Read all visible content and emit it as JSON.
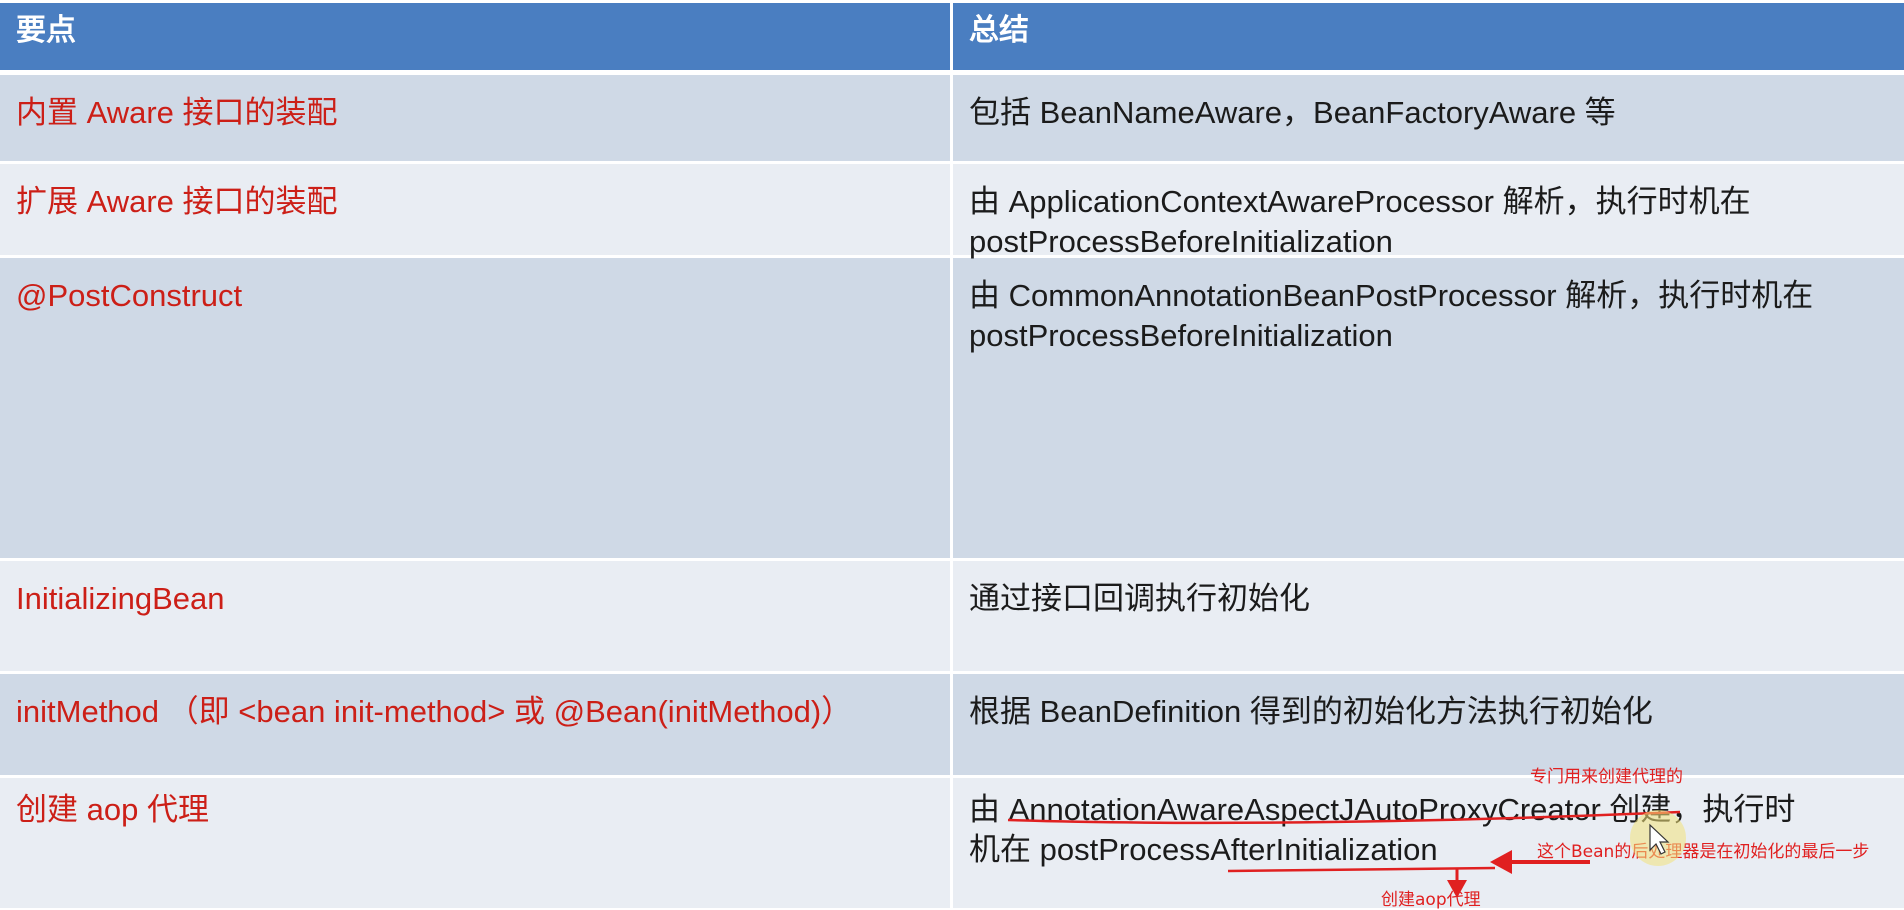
{
  "header": {
    "col1": "要点",
    "col2": "总结"
  },
  "rows": [
    {
      "key": "内置 Aware 接口的装配",
      "summary": "包括 BeanNameAware，BeanFactoryAware 等"
    },
    {
      "key": "扩展 Aware 接口的装配",
      "summary_l1": "由 ApplicationContextAwareProcessor 解析，执行时机在",
      "summary_l2": "postProcessBeforeInitialization"
    },
    {
      "key": "@PostConstruct",
      "summary_l1": "由 CommonAnnotationBeanPostProcessor 解析，执行时机在",
      "summary_l2": "postProcessBeforeInitialization"
    },
    {
      "key": "InitializingBean",
      "summary": "通过接口回调执行初始化"
    },
    {
      "key": "initMethod （即 <bean init-method> 或 @Bean(initMethod)）",
      "summary": "根据 BeanDefinition 得到的初始化方法执行初始化"
    },
    {
      "key": "创建 aop 代理",
      "summary_l1": "由 AnnotationAwareAspectJAutoProxyCreator 创建，执行时",
      "summary_l2": "机在 postProcessAfterInitialization"
    }
  ],
  "annotations": {
    "top_note": "专门用来创建代理的",
    "side_note": "这个Bean的后处理器是在初始化的最后一步",
    "bottom_note": "创建aop代理"
  },
  "colors": {
    "header_bg": "#4a7ec1",
    "row_dark": "#cfd9e6",
    "row_light": "#e9edf3",
    "key_text": "#cc1f17",
    "annotation": "#e02020"
  }
}
